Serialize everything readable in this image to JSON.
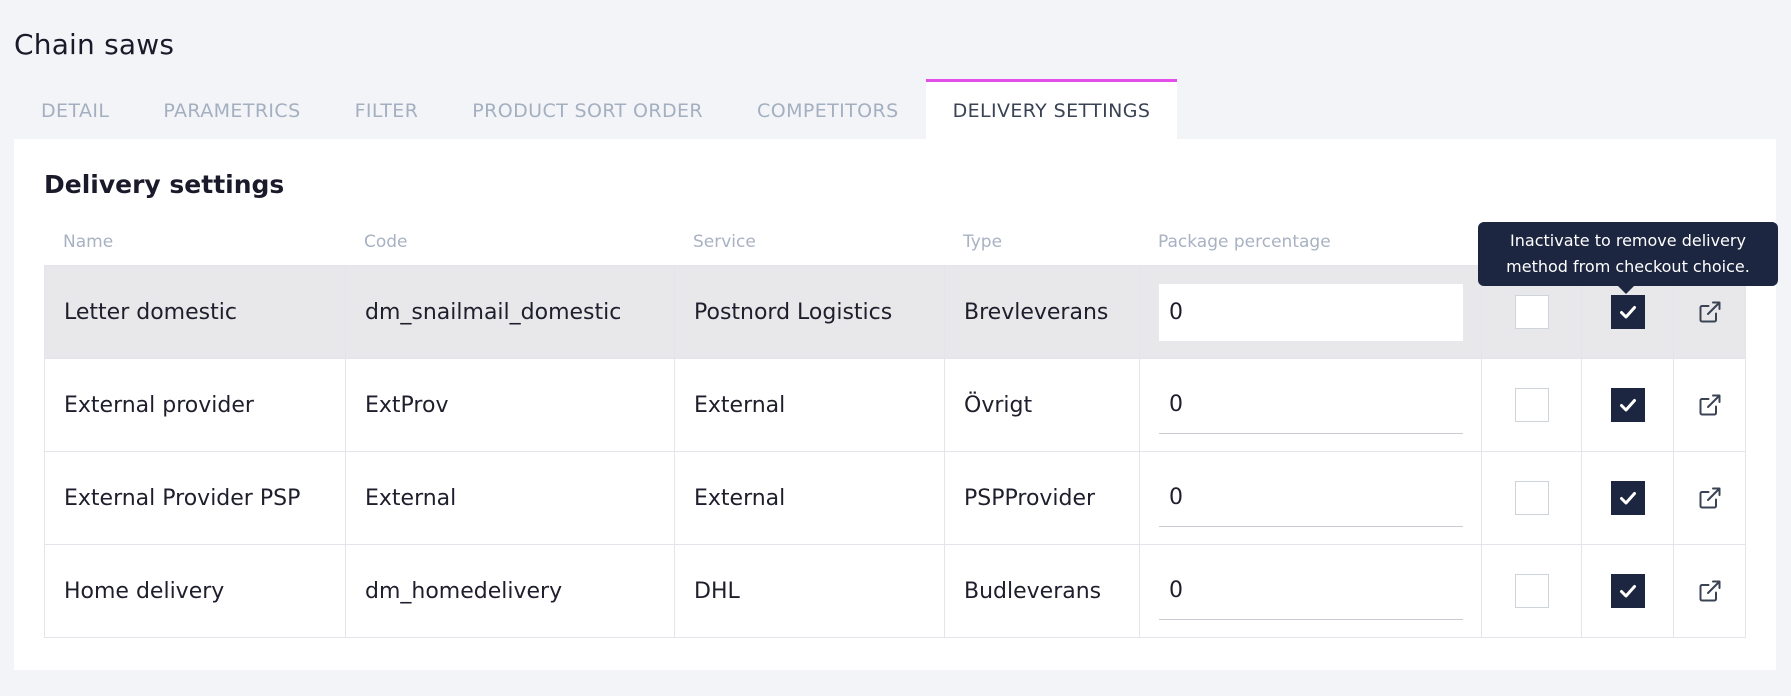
{
  "page": {
    "title": "Chain saws"
  },
  "tabs": [
    {
      "label": "DETAIL"
    },
    {
      "label": "PARAMETRICS"
    },
    {
      "label": "FILTER"
    },
    {
      "label": "PRODUCT SORT ORDER"
    },
    {
      "label": "COMPETITORS"
    },
    {
      "label": "DELIVERY SETTINGS"
    }
  ],
  "section": {
    "title": "Delivery settings"
  },
  "table": {
    "headers": {
      "name": "Name",
      "code": "Code",
      "service": "Service",
      "type": "Type",
      "package_percentage": "Package percentage"
    },
    "rows": [
      {
        "name": "Letter domestic",
        "code": "dm_snailmail_domestic",
        "service": "Postnord Logistics",
        "type": "Brevleverans",
        "package_percentage": "0",
        "checkbox1": false,
        "active": true
      },
      {
        "name": "External provider",
        "code": "ExtProv",
        "service": "External",
        "type": "Övrigt",
        "package_percentage": "0",
        "checkbox1": false,
        "active": true
      },
      {
        "name": "External Provider PSP",
        "code": "External",
        "service": "External",
        "type": "PSPProvider",
        "package_percentage": "0",
        "checkbox1": false,
        "active": true
      },
      {
        "name": "Home delivery",
        "code": "dm_homedelivery",
        "service": "DHL",
        "type": "Budleverans",
        "package_percentage": "0",
        "checkbox1": false,
        "active": true
      }
    ]
  },
  "tooltip": {
    "line1": "Inactivate to remove delivery",
    "line2": "method from checkout choice."
  },
  "colors": {
    "active_tab_accent": "#e34de8",
    "checkbox_checked": "#1d2640",
    "tooltip_bg": "#1d2640",
    "hover_row_bg": "#e8e8ea"
  },
  "icons": {
    "checkmark": "check-icon",
    "open_link": "external-link-icon"
  }
}
